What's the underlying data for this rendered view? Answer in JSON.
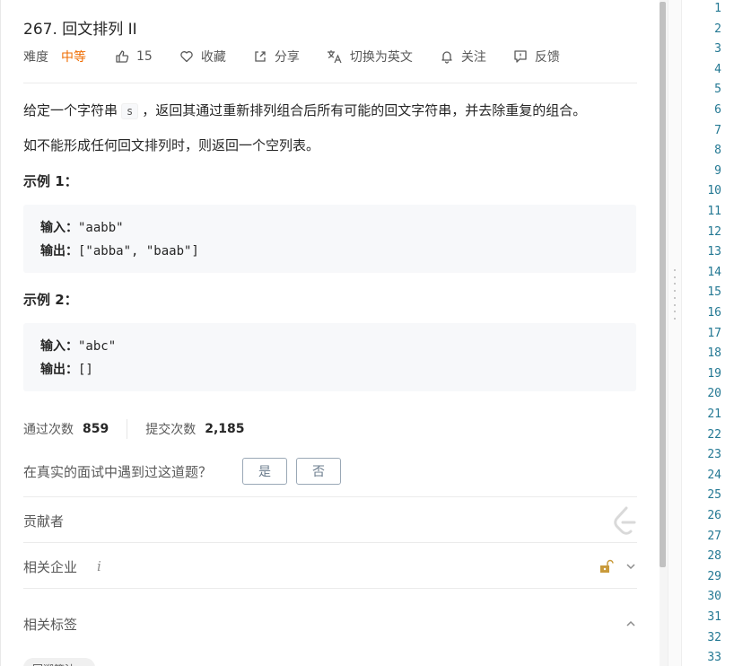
{
  "problem": {
    "title": "267. 回文排列 II",
    "difficulty_label": "难度",
    "difficulty": "中等",
    "likes": "15",
    "favorite": "收藏",
    "share": "分享",
    "switch_lang": "切换为英文",
    "follow": "关注",
    "feedback": "反馈"
  },
  "description": {
    "p1_before": "给定一个字符串",
    "p1_code": "s",
    "p1_after": "，返回其通过重新排列组合后所有可能的回文字符串，并去除重复的组合。",
    "p2": "如不能形成任何回文排列时，则返回一个空列表。"
  },
  "examples": [
    {
      "title": "示例 1：",
      "input_label": "输入：",
      "input": "\"aabb\"",
      "output_label": "输出：",
      "output": "[\"abba\", \"baab\"]"
    },
    {
      "title": "示例 2：",
      "input_label": "输入：",
      "input": "\"abc\"",
      "output_label": "输出：",
      "output": "[]"
    }
  ],
  "stats": {
    "accepted_label": "通过次数",
    "accepted": "859",
    "submissions_label": "提交次数",
    "submissions": "2,185"
  },
  "interview": {
    "question": "在真实的面试中遇到过这道题？",
    "yes": "是",
    "no": "否"
  },
  "sections": {
    "contributors": "贡献者",
    "companies": "相关企业",
    "companies_info": "i",
    "tags": "相关标签",
    "tag_partial": "回溯算法"
  },
  "editor": {
    "line_numbers": [
      "1",
      "2",
      "3",
      "4",
      "5",
      "6",
      "7",
      "8",
      "9",
      "10",
      "11",
      "12",
      "13",
      "14",
      "15",
      "16",
      "17",
      "18",
      "19",
      "20",
      "21",
      "22",
      "23",
      "24",
      "25",
      "26",
      "27",
      "28",
      "29",
      "30",
      "31",
      "32",
      "33"
    ]
  },
  "colors": {
    "difficulty_medium": "#ef6c00",
    "line_number": "#237893",
    "lock": "#c99a3b"
  },
  "icons": [
    "thumb-up-icon",
    "heart-icon",
    "share-icon",
    "translate-icon",
    "bell-icon",
    "feedback-icon",
    "leetcode-logo-icon",
    "unlock-icon",
    "chevron-down-icon",
    "chevron-up-icon"
  ]
}
